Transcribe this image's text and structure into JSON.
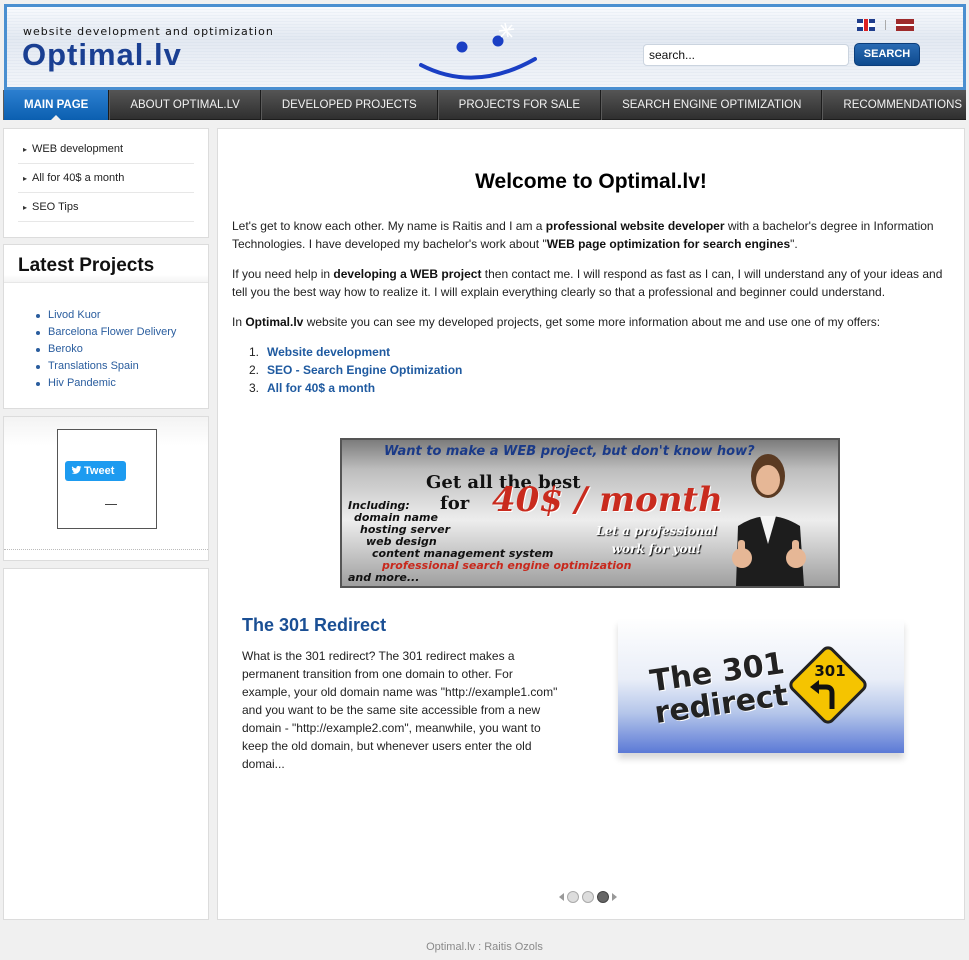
{
  "header": {
    "tagline": "website development and optimization",
    "logo": "Optimal.lv",
    "search": {
      "value": "search...",
      "button_label": "SEARCH"
    },
    "flags": [
      "uk-flag-icon",
      "latvia-flag-icon"
    ]
  },
  "nav": {
    "items": [
      {
        "label": "MAIN PAGE",
        "active": true
      },
      {
        "label": "ABOUT OPTIMAL.LV"
      },
      {
        "label": "DEVELOPED PROJECTS"
      },
      {
        "label": "PROJECTS FOR SALE"
      },
      {
        "label": "SEARCH ENGINE OPTIMIZATION"
      },
      {
        "label": "RECOMMENDATIONS"
      }
    ]
  },
  "sidebar": {
    "services": [
      "WEB development",
      "All for 40$ a month",
      "SEO Tips"
    ],
    "projects_title": "Latest Projects",
    "projects": [
      "Livod Kuor",
      "Barcelona Flower Delivery",
      "Beroko",
      "Translations Spain",
      "Hiv Pandemic"
    ],
    "tweet_label": "Tweet"
  },
  "main": {
    "title": "Welcome to Optimal.lv!",
    "para1": {
      "a": "Let's get to know each other. My name is Raitis and I am a ",
      "b": "professional website developer",
      "c": " with a bachelor's degree in Information Technologies. I have developed my bachelor's work about \"",
      "d": "WEB page optimization for search engines",
      "e": "\"."
    },
    "para2": {
      "a": "If you need help in ",
      "b": "developing a WEB project",
      "c": " then contact me. I will respond as fast as I can, I will understand any of your ideas and tell you the best way how to realize it. I will explain everything clearly so that a professional and beginner could understand."
    },
    "para3": {
      "a": "In ",
      "b": "Optimal.lv",
      "c": " website you can see my developed projects, get some more information about me and use one of my offers:"
    },
    "offers": [
      {
        "num": "1.",
        "label": "Website development"
      },
      {
        "num": "2.",
        "label": "SEO - Search Engine Optimization"
      },
      {
        "num": "3.",
        "label": "All for 40$ a month"
      }
    ],
    "banner": {
      "top": "Want to make a WEB project, but don't know how?",
      "get": "Get all the best",
      "for": "for",
      "price": "40$ / month",
      "pro1": "Let a professional",
      "pro2": "work for you!",
      "incl": [
        "Including:",
        "domain name",
        "hosting server",
        "web design",
        "content management system",
        "professional search engine optimization",
        "and more..."
      ]
    },
    "article": {
      "title": "The 301 Redirect",
      "text": "What is the 301 redirect? The 301 redirect makes a permanent transition from one domain to other. For example, your old domain name was \"http://example1.com\" and you want to be the same site accessible from a new domain - \"http://example2.com\", meanwhile, you want to keep the old domain, but whenever users enter the old domai...",
      "image_line1": "The 301",
      "image_line2": "redirect",
      "sign_number": "301"
    },
    "slider": {
      "count": 3,
      "active": 3
    }
  },
  "footer": {
    "text": "Optimal.lv : Raitis Ozols"
  },
  "colors": {
    "accent": "#0b5fb0",
    "link": "#1f5aa0",
    "nav_bg": "#3a3a3a"
  }
}
